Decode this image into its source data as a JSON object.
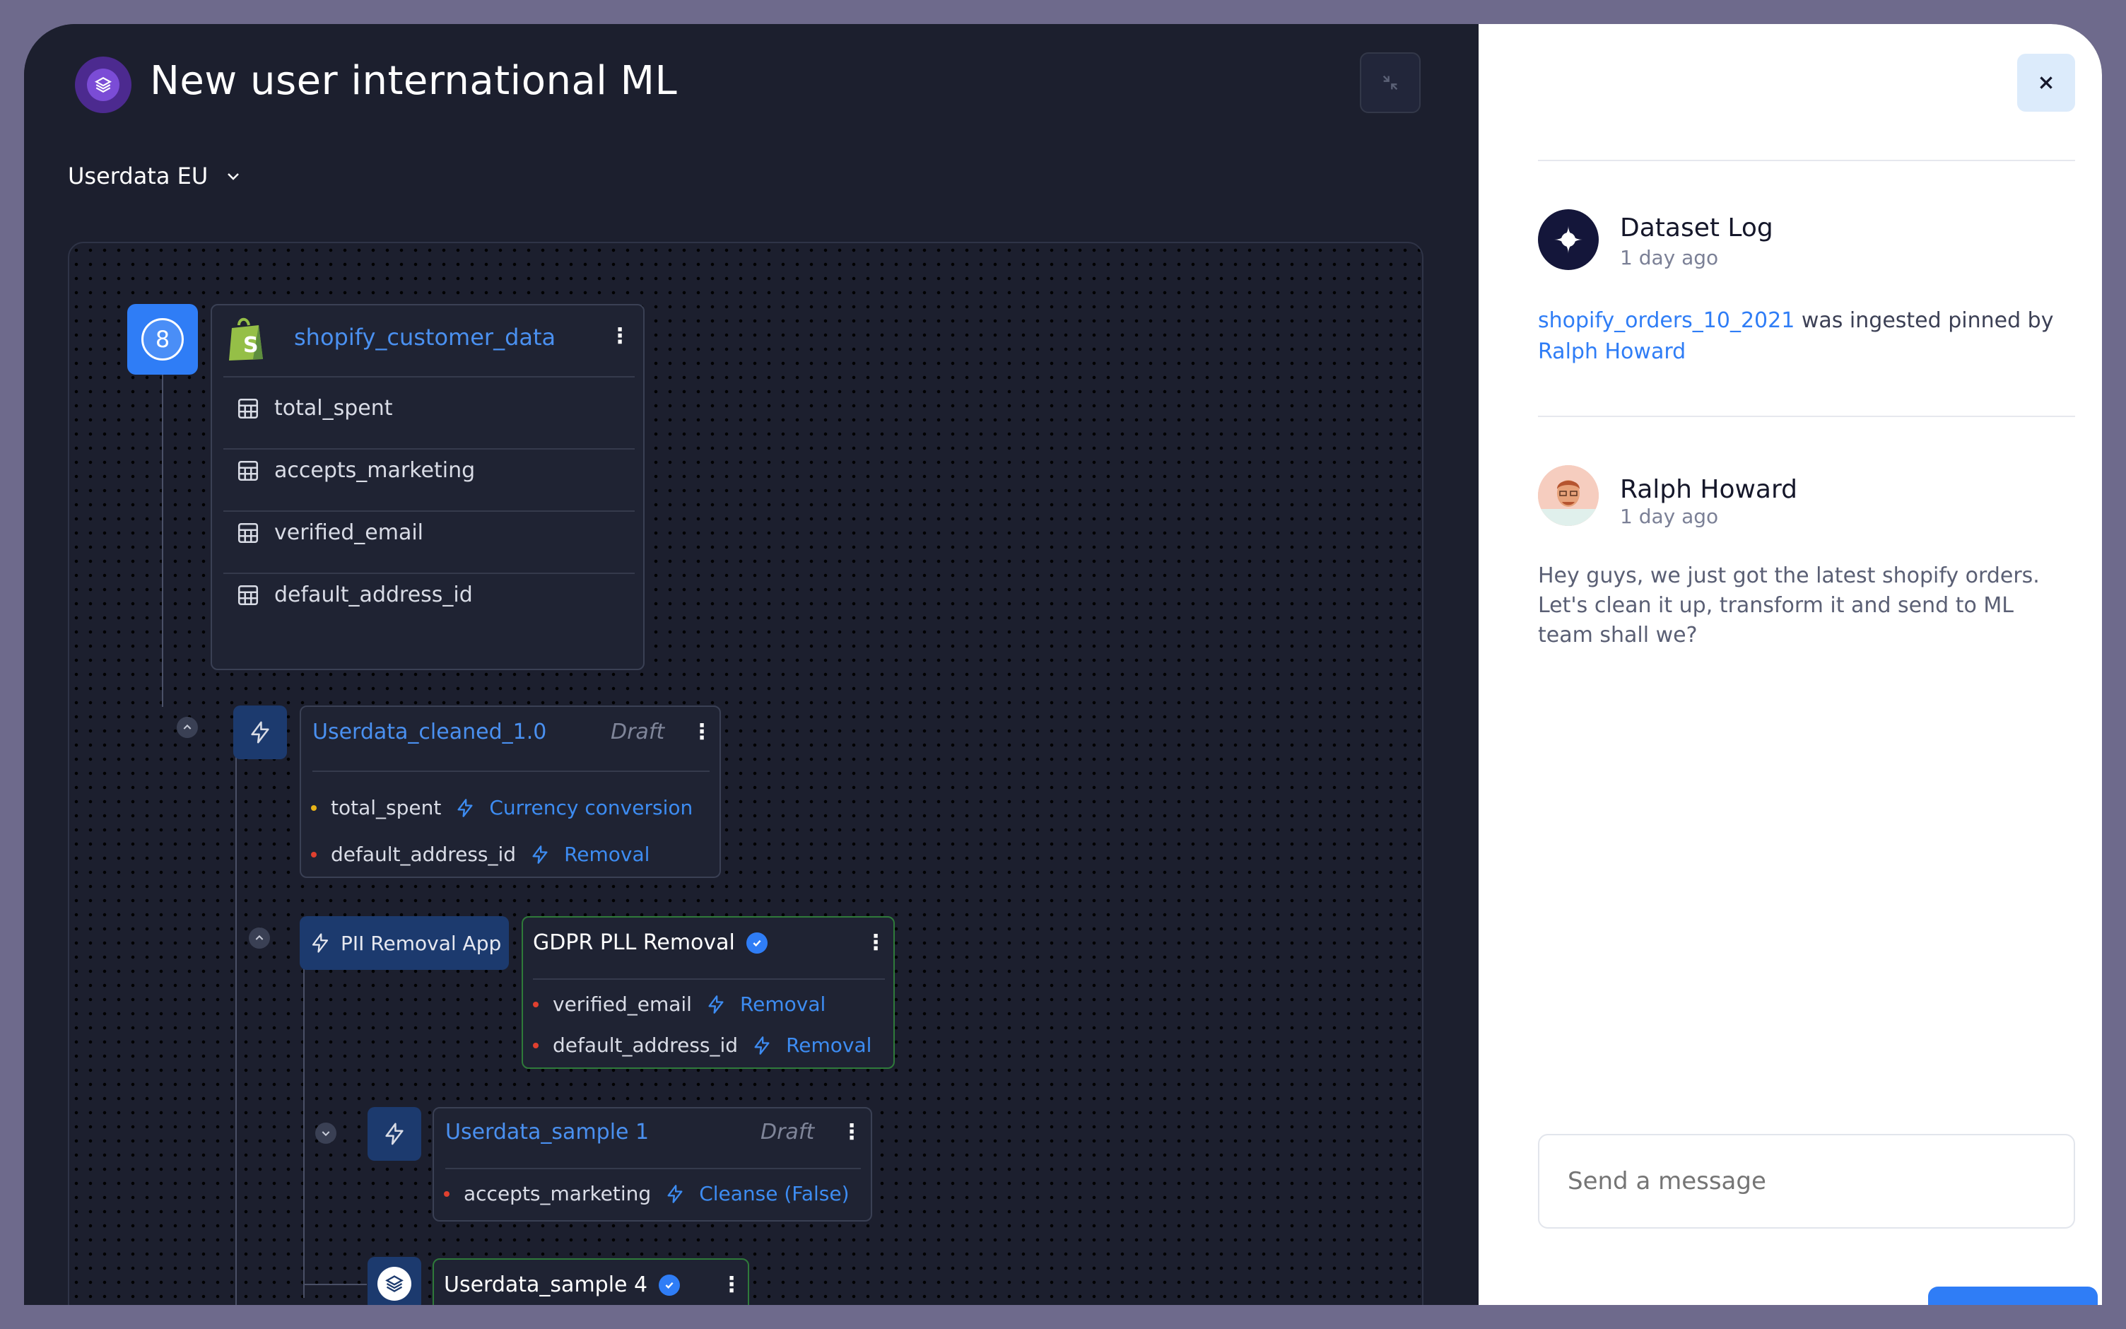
{
  "header": {
    "title": "New user international ML"
  },
  "dataset_selector": {
    "value": "Userdata EU"
  },
  "source": {
    "badge": "8",
    "name": "shopify_customer_data",
    "fields": [
      "total_spent",
      "accepts_marketing",
      "verified_email",
      "default_address_id"
    ]
  },
  "cleaned": {
    "name": "Userdata_cleaned_1.0",
    "status": "Draft",
    "rules": [
      {
        "field": "total_spent",
        "action": "Currency conversion",
        "dot_color": "#e8b418"
      },
      {
        "field": "default_address_id",
        "action": "Removal",
        "dot_color": "#e0402f"
      }
    ]
  },
  "pii_app": {
    "label": "PII Removal App",
    "card_title": "GDPR PLL Removal",
    "rules": [
      {
        "field": "verified_email",
        "action": "Removal",
        "dot_color": "#e0402f"
      },
      {
        "field": "default_address_id",
        "action": "Removal",
        "dot_color": "#e0402f"
      }
    ]
  },
  "sample1": {
    "name": "Userdata_sample 1",
    "status": "Draft",
    "rules": [
      {
        "field": "accepts_marketing",
        "action": "Cleanse (False)",
        "dot_color": "#e0402f"
      }
    ]
  },
  "sample4": {
    "name": "Userdata_sample 4"
  },
  "activity": {
    "log": {
      "title": "Dataset Log",
      "time": "1 day ago",
      "dataset_link": "shopify_orders_10_2021",
      "middle_text": " was ingested pinned by ",
      "user_link": "Ralph Howard"
    },
    "message": {
      "author": "Ralph Howard",
      "time": "1 day ago",
      "text": "Hey guys, we just got the latest shopify orders. Let's clean it up, transform it and send to ML team shall we?"
    },
    "input": {
      "placeholder": "Send a message"
    }
  },
  "colors": {
    "accent": "#2f7df6",
    "panel_dark": "#1c1f2e",
    "verified_border": "#2f7a3a"
  }
}
